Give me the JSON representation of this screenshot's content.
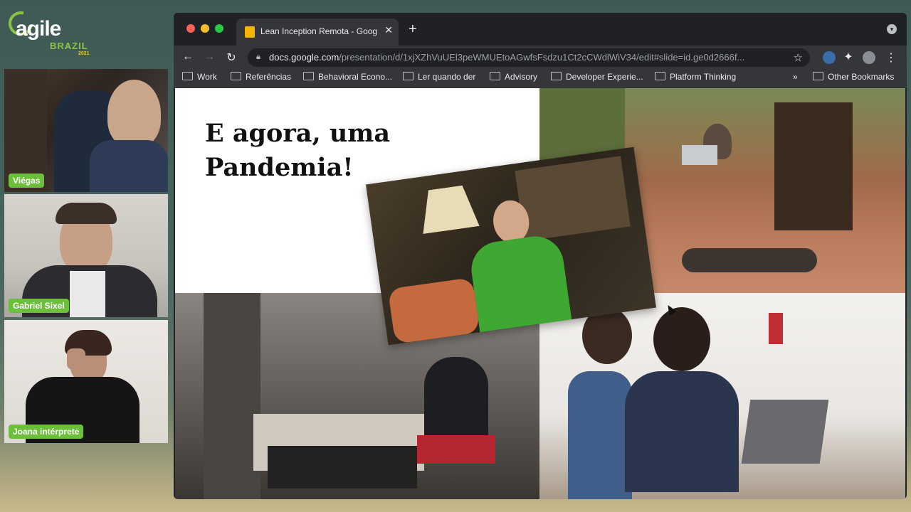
{
  "conference": {
    "logo_word": "agile",
    "logo_country": "BRAZIL",
    "logo_year": "2021"
  },
  "participants": [
    {
      "name": "Viégas"
    },
    {
      "name": "Gabriel Sixel"
    },
    {
      "name": "Joana intérprete"
    }
  ],
  "browser": {
    "tab_title": "Lean Inception Remota - Goog",
    "url_host": "docs.google.com",
    "url_path": "/presentation/d/1xjXZhVuUEl3peWMUEtoAGwfsFsdzu1Ct2cCWdlWiV34/edit#slide=id.ge0d2666f...",
    "bookmarks": [
      "Work",
      "Referências",
      "Behavioral Econo...",
      "Ler quando der",
      "Advisory",
      "Developer Experie...",
      "Platform Thinking"
    ],
    "overflow": "»",
    "other_bookmarks": "Other Bookmarks"
  },
  "slide": {
    "title_line1": "E agora, uma",
    "title_line2": "Pandemia!"
  },
  "colors": {
    "name_badge": "#6cbf3b",
    "slides_icon": "#f4b400",
    "chrome_dark": "#202124",
    "chrome_toolbar": "#35363a"
  }
}
